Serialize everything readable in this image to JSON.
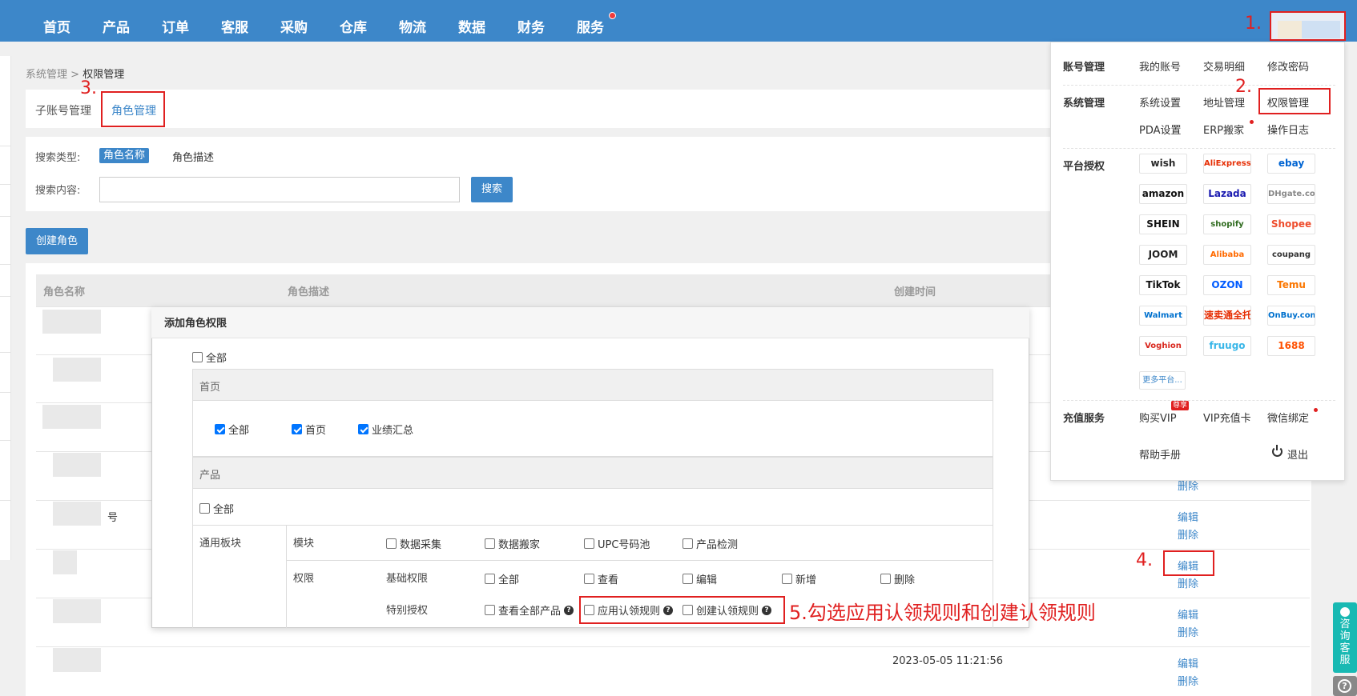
{
  "topnav": {
    "items": [
      "首页",
      "产品",
      "订单",
      "客服",
      "采购",
      "仓库",
      "物流",
      "数据",
      "财务",
      "服务"
    ],
    "bg_color": "#3d87c9"
  },
  "annotations": {
    "m1": "1.",
    "m2": "2.",
    "m3": "3.",
    "m4": "4.",
    "m5": "5.勾选应用认领规则和创建认领规则",
    "color": "#e02020"
  },
  "breadcrumb": {
    "parent": "系统管理",
    "sep": ">",
    "current": "权限管理"
  },
  "tabs": [
    "子账号管理",
    "角色管理"
  ],
  "search": {
    "type_label": "搜索类型:",
    "type_options": [
      "角色名称",
      "角色描述"
    ],
    "content_label": "搜索内容:",
    "input_value": "",
    "button": "搜索"
  },
  "create_button": "创建角色",
  "table": {
    "headers": [
      "角色名称",
      "角色描述",
      "创建时间"
    ],
    "partial_name": "号",
    "last_date": "2023-05-05 11:21:56",
    "actions": {
      "edit": "编辑",
      "delete": "删除"
    }
  },
  "modal": {
    "title": "添加角色权限",
    "select_all": "全部",
    "sections": {
      "home": {
        "title": "首页",
        "options": [
          {
            "label": "全部",
            "checked": true
          },
          {
            "label": "首页",
            "checked": true
          },
          {
            "label": "业绩汇总",
            "checked": true
          }
        ]
      },
      "product": {
        "title": "产品",
        "select_all": "全部",
        "group_label": "通用板块",
        "module_label": "模块",
        "modules": [
          "数据采集",
          "数据搬家",
          "UPC号码池",
          "产品检测"
        ],
        "perm_label": "权限",
        "basic_label": "基础权限",
        "basic": [
          "全部",
          "查看",
          "编辑",
          "新增",
          "删除"
        ],
        "special_label": "特别授权",
        "special": [
          "查看全部产品",
          "应用认领规则",
          "创建认领规则"
        ]
      }
    }
  },
  "dropdown": {
    "account": {
      "title": "账号管理",
      "items": [
        "我的账号",
        "交易明细",
        "修改密码"
      ]
    },
    "system": {
      "title": "系统管理",
      "items": [
        "系统设置",
        "地址管理",
        "权限管理",
        "PDA设置",
        "ERP搬家",
        "操作日志"
      ]
    },
    "platform": {
      "title": "平台授权",
      "items": [
        {
          "name": "wish",
          "color": "#2a2a2a"
        },
        {
          "name": "AliExpress",
          "color": "#e62e04"
        },
        {
          "name": "ebay",
          "color": "#0064d2"
        },
        {
          "name": "amazon",
          "color": "#111111"
        },
        {
          "name": "Lazada",
          "color": "#1a1ab0"
        },
        {
          "name": "DHgate.com",
          "color": "#888888"
        },
        {
          "name": "SHEIN",
          "color": "#111111"
        },
        {
          "name": "shopify",
          "color": "#2f6b1f"
        },
        {
          "name": "Shopee",
          "color": "#ee4d2d"
        },
        {
          "name": "JOOM",
          "color": "#222222"
        },
        {
          "name": "Alibaba",
          "color": "#ff6a00"
        },
        {
          "name": "coupang",
          "color": "#333333"
        },
        {
          "name": "TikTok",
          "color": "#111111"
        },
        {
          "name": "OZON",
          "color": "#005bff"
        },
        {
          "name": "Temu",
          "color": "#fb7701"
        },
        {
          "name": "Walmart",
          "color": "#0071ce"
        },
        {
          "name": "速卖通全托管",
          "color": "#e62e04"
        },
        {
          "name": "OnBuy.com",
          "color": "#0071ce"
        },
        {
          "name": "Voghion",
          "color": "#d9261c"
        },
        {
          "name": "fruugo",
          "color": "#38b6e8"
        },
        {
          "name": "1688",
          "color": "#ff5000"
        }
      ],
      "more": "更多平台..."
    },
    "recharge": {
      "title": "充值服务",
      "items": [
        "购买VIP",
        "VIP充值卡",
        "微信绑定"
      ],
      "vip_tag": "尊享"
    },
    "help": "帮助手册",
    "logout": "退出"
  },
  "side_float": {
    "kefu": "咨询客服",
    "help": "?"
  }
}
